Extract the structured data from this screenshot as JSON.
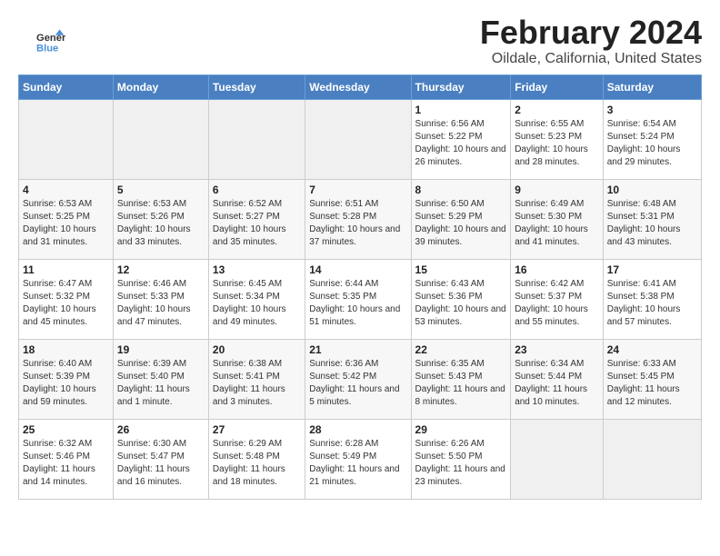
{
  "app": {
    "logo_text_general": "General",
    "logo_text_blue": "Blue"
  },
  "header": {
    "month_year": "February 2024",
    "location": "Oildale, California, United States"
  },
  "calendar": {
    "days_of_week": [
      "Sunday",
      "Monday",
      "Tuesday",
      "Wednesday",
      "Thursday",
      "Friday",
      "Saturday"
    ],
    "weeks": [
      [
        {
          "day": "",
          "sunrise": "",
          "sunset": "",
          "daylight": "",
          "empty": true
        },
        {
          "day": "",
          "sunrise": "",
          "sunset": "",
          "daylight": "",
          "empty": true
        },
        {
          "day": "",
          "sunrise": "",
          "sunset": "",
          "daylight": "",
          "empty": true
        },
        {
          "day": "",
          "sunrise": "",
          "sunset": "",
          "daylight": "",
          "empty": true
        },
        {
          "day": "1",
          "sunrise": "Sunrise: 6:56 AM",
          "sunset": "Sunset: 5:22 PM",
          "daylight": "Daylight: 10 hours and 26 minutes."
        },
        {
          "day": "2",
          "sunrise": "Sunrise: 6:55 AM",
          "sunset": "Sunset: 5:23 PM",
          "daylight": "Daylight: 10 hours and 28 minutes."
        },
        {
          "day": "3",
          "sunrise": "Sunrise: 6:54 AM",
          "sunset": "Sunset: 5:24 PM",
          "daylight": "Daylight: 10 hours and 29 minutes."
        }
      ],
      [
        {
          "day": "4",
          "sunrise": "Sunrise: 6:53 AM",
          "sunset": "Sunset: 5:25 PM",
          "daylight": "Daylight: 10 hours and 31 minutes."
        },
        {
          "day": "5",
          "sunrise": "Sunrise: 6:53 AM",
          "sunset": "Sunset: 5:26 PM",
          "daylight": "Daylight: 10 hours and 33 minutes."
        },
        {
          "day": "6",
          "sunrise": "Sunrise: 6:52 AM",
          "sunset": "Sunset: 5:27 PM",
          "daylight": "Daylight: 10 hours and 35 minutes."
        },
        {
          "day": "7",
          "sunrise": "Sunrise: 6:51 AM",
          "sunset": "Sunset: 5:28 PM",
          "daylight": "Daylight: 10 hours and 37 minutes."
        },
        {
          "day": "8",
          "sunrise": "Sunrise: 6:50 AM",
          "sunset": "Sunset: 5:29 PM",
          "daylight": "Daylight: 10 hours and 39 minutes."
        },
        {
          "day": "9",
          "sunrise": "Sunrise: 6:49 AM",
          "sunset": "Sunset: 5:30 PM",
          "daylight": "Daylight: 10 hours and 41 minutes."
        },
        {
          "day": "10",
          "sunrise": "Sunrise: 6:48 AM",
          "sunset": "Sunset: 5:31 PM",
          "daylight": "Daylight: 10 hours and 43 minutes."
        }
      ],
      [
        {
          "day": "11",
          "sunrise": "Sunrise: 6:47 AM",
          "sunset": "Sunset: 5:32 PM",
          "daylight": "Daylight: 10 hours and 45 minutes."
        },
        {
          "day": "12",
          "sunrise": "Sunrise: 6:46 AM",
          "sunset": "Sunset: 5:33 PM",
          "daylight": "Daylight: 10 hours and 47 minutes."
        },
        {
          "day": "13",
          "sunrise": "Sunrise: 6:45 AM",
          "sunset": "Sunset: 5:34 PM",
          "daylight": "Daylight: 10 hours and 49 minutes."
        },
        {
          "day": "14",
          "sunrise": "Sunrise: 6:44 AM",
          "sunset": "Sunset: 5:35 PM",
          "daylight": "Daylight: 10 hours and 51 minutes."
        },
        {
          "day": "15",
          "sunrise": "Sunrise: 6:43 AM",
          "sunset": "Sunset: 5:36 PM",
          "daylight": "Daylight: 10 hours and 53 minutes."
        },
        {
          "day": "16",
          "sunrise": "Sunrise: 6:42 AM",
          "sunset": "Sunset: 5:37 PM",
          "daylight": "Daylight: 10 hours and 55 minutes."
        },
        {
          "day": "17",
          "sunrise": "Sunrise: 6:41 AM",
          "sunset": "Sunset: 5:38 PM",
          "daylight": "Daylight: 10 hours and 57 minutes."
        }
      ],
      [
        {
          "day": "18",
          "sunrise": "Sunrise: 6:40 AM",
          "sunset": "Sunset: 5:39 PM",
          "daylight": "Daylight: 10 hours and 59 minutes."
        },
        {
          "day": "19",
          "sunrise": "Sunrise: 6:39 AM",
          "sunset": "Sunset: 5:40 PM",
          "daylight": "Daylight: 11 hours and 1 minute."
        },
        {
          "day": "20",
          "sunrise": "Sunrise: 6:38 AM",
          "sunset": "Sunset: 5:41 PM",
          "daylight": "Daylight: 11 hours and 3 minutes."
        },
        {
          "day": "21",
          "sunrise": "Sunrise: 6:36 AM",
          "sunset": "Sunset: 5:42 PM",
          "daylight": "Daylight: 11 hours and 5 minutes."
        },
        {
          "day": "22",
          "sunrise": "Sunrise: 6:35 AM",
          "sunset": "Sunset: 5:43 PM",
          "daylight": "Daylight: 11 hours and 8 minutes."
        },
        {
          "day": "23",
          "sunrise": "Sunrise: 6:34 AM",
          "sunset": "Sunset: 5:44 PM",
          "daylight": "Daylight: 11 hours and 10 minutes."
        },
        {
          "day": "24",
          "sunrise": "Sunrise: 6:33 AM",
          "sunset": "Sunset: 5:45 PM",
          "daylight": "Daylight: 11 hours and 12 minutes."
        }
      ],
      [
        {
          "day": "25",
          "sunrise": "Sunrise: 6:32 AM",
          "sunset": "Sunset: 5:46 PM",
          "daylight": "Daylight: 11 hours and 14 minutes."
        },
        {
          "day": "26",
          "sunrise": "Sunrise: 6:30 AM",
          "sunset": "Sunset: 5:47 PM",
          "daylight": "Daylight: 11 hours and 16 minutes."
        },
        {
          "day": "27",
          "sunrise": "Sunrise: 6:29 AM",
          "sunset": "Sunset: 5:48 PM",
          "daylight": "Daylight: 11 hours and 18 minutes."
        },
        {
          "day": "28",
          "sunrise": "Sunrise: 6:28 AM",
          "sunset": "Sunset: 5:49 PM",
          "daylight": "Daylight: 11 hours and 21 minutes."
        },
        {
          "day": "29",
          "sunrise": "Sunrise: 6:26 AM",
          "sunset": "Sunset: 5:50 PM",
          "daylight": "Daylight: 11 hours and 23 minutes."
        },
        {
          "day": "",
          "sunrise": "",
          "sunset": "",
          "daylight": "",
          "empty": true
        },
        {
          "day": "",
          "sunrise": "",
          "sunset": "",
          "daylight": "",
          "empty": true
        }
      ]
    ]
  }
}
